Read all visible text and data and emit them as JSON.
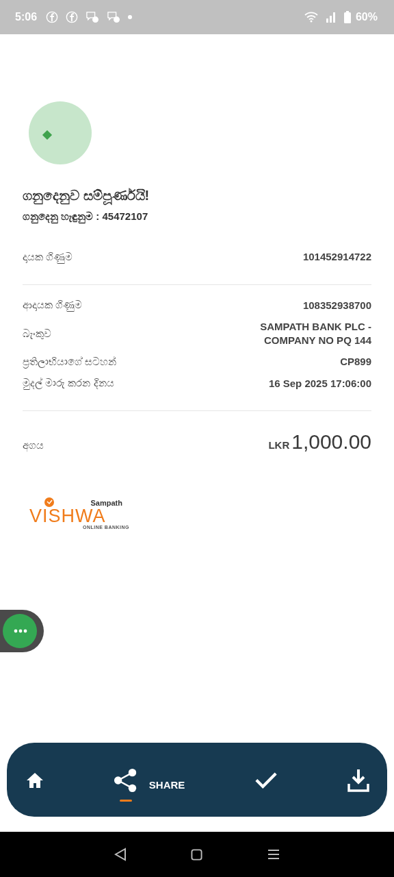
{
  "status_bar": {
    "time": "5:06",
    "battery": "60%"
  },
  "result": {
    "title": "ගනුදෙනුව සම්පූර්ණයි!",
    "reference": "ගනුදෙනු හැඳුනුම : 45472107"
  },
  "sections": [
    {
      "rows": [
        {
          "label": "දායක ගිණුම",
          "value": "101452914722"
        }
      ]
    },
    {
      "rows": [
        {
          "label": "ආදායක ගිණුම",
          "value": "108352938700"
        },
        {
          "label": "බැංකුව",
          "value": "SAMPATH BANK PLC - COMPANY NO PQ 144"
        },
        {
          "label": "ප්‍රතිලාභියාගේ සටහන්",
          "value": "CP899"
        },
        {
          "label": "මුදල් මාරු කරන දිනය",
          "value": "16 Sep 2025 17:06:00"
        }
      ]
    }
  ],
  "amount": {
    "label": "අගය",
    "currency": "LKR",
    "value": "1,000.00"
  },
  "logo": {
    "brand": "Sampath",
    "name": "VISHWA",
    "tagline": "ONLINE BANKING"
  },
  "bottom_bar": [
    {
      "kind": "home",
      "selected": false
    },
    {
      "kind": "share",
      "label": "SHARE",
      "selected": true
    },
    {
      "kind": "check",
      "selected": false
    },
    {
      "kind": "download",
      "selected": false
    }
  ]
}
